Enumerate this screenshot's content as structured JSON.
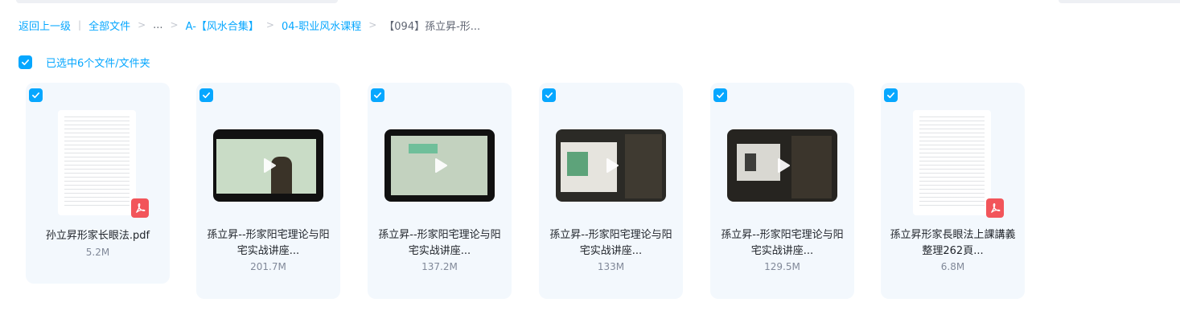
{
  "breadcrumb": {
    "back": "返回上一级",
    "all_files": "全部文件",
    "ellipsis": "...",
    "level1": "A-【风水合集】",
    "level2": "04-职业风水课程",
    "current": "【094】孫立昇-形..."
  },
  "selection": {
    "label": "已选中6个文件/文件夹"
  },
  "files": [
    {
      "name": "孙立昇形家长眼法.pdf",
      "size": "5.2M",
      "type": "pdf"
    },
    {
      "name": "孫立昇--形家阳宅理论与阳宅实战讲座...",
      "size": "201.7M",
      "type": "video"
    },
    {
      "name": "孫立昇--形家阳宅理论与阳宅实战讲座...",
      "size": "137.2M",
      "type": "video"
    },
    {
      "name": "孫立昇--形家阳宅理论与阳宅实战讲座...",
      "size": "133M",
      "type": "video"
    },
    {
      "name": "孫立昇--形家阳宅理论与阳宅实战讲座...",
      "size": "129.5M",
      "type": "video"
    },
    {
      "name": "孫立昇形家長眼法上課講義整理262頁...",
      "size": "6.8M",
      "type": "pdf"
    }
  ],
  "icons": {
    "checkbox": "checkmark-icon",
    "play": "play-icon",
    "pdf": "pdf-file-icon"
  },
  "colors": {
    "accent": "#06a7ff",
    "card_bg": "#f3f8fd",
    "pdf_red": "#f2555a"
  }
}
